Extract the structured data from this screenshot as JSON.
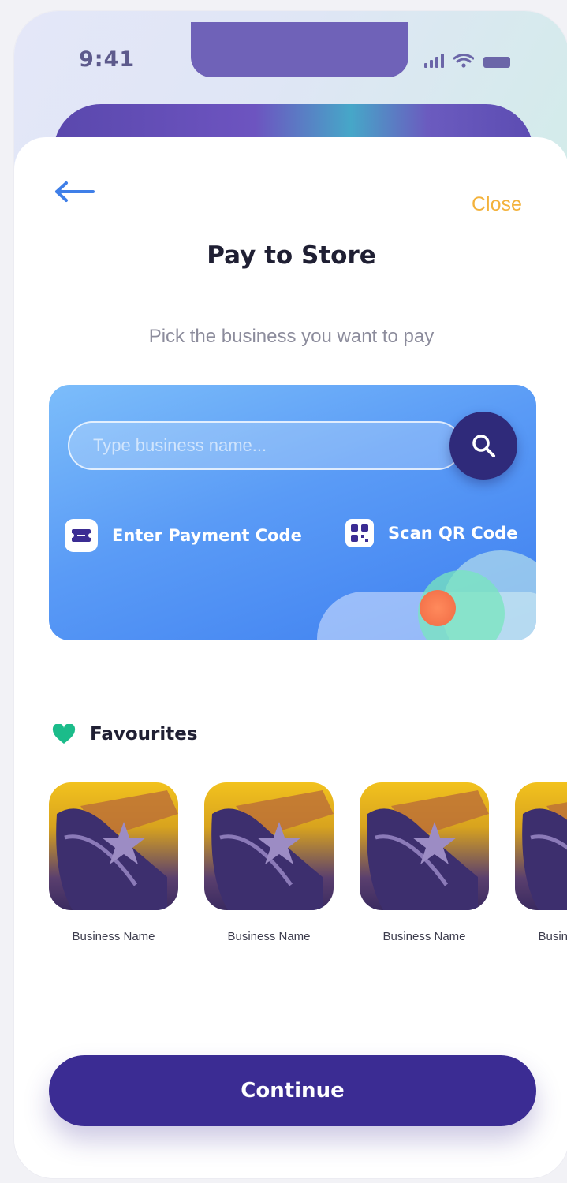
{
  "status_bar": {
    "time": "9:41",
    "icons": [
      "cellular-signal-icon",
      "wifi-icon",
      "battery-icon"
    ]
  },
  "nav": {
    "back_icon": "arrow-left-icon",
    "close_label": "Close"
  },
  "title": "Pay to Store",
  "subtitle": "Pick the business you want to pay",
  "search": {
    "placeholder": "Type business name...",
    "button_icon": "search-icon"
  },
  "actions": {
    "payment_code_label": "Enter Payment Code",
    "payment_code_icon": "ticket-icon",
    "scan_qr_label": "Scan QR Code",
    "scan_qr_icon": "qr-code-icon"
  },
  "favourites": {
    "title": "Favourites",
    "icon": "heart-icon",
    "items": [
      {
        "name": "Business Name"
      },
      {
        "name": "Business Name"
      },
      {
        "name": "Business Name"
      },
      {
        "name": "Business Name"
      }
    ]
  },
  "continue_label": "Continue",
  "colors": {
    "accent": "#3b2c93",
    "close": "#f3b23c",
    "heart": "#1bbc8a",
    "card_top": "#7cbdfa",
    "card_bottom": "#3e7ff0",
    "back_arrow": "#3f7fe8"
  }
}
